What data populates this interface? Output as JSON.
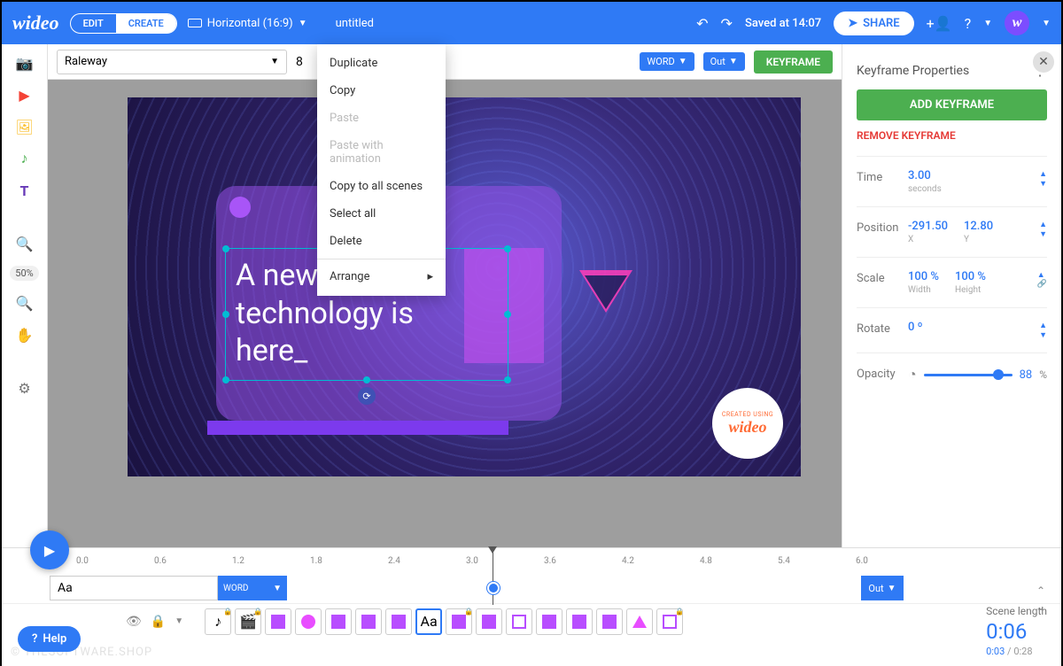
{
  "header": {
    "logo": "wideo",
    "edit": "EDIT",
    "create": "CREATE",
    "orientation": "Horizontal (16:9)",
    "title": "untitled",
    "saved": "Saved at 14:07",
    "share": "SHARE"
  },
  "toolbar": {
    "font": "Raleway",
    "font_size": "8",
    "word_btn": "WORD",
    "out_btn": "Out",
    "keyframe_btn": "KEYFRAME"
  },
  "left_tools": {
    "zoom": "50%"
  },
  "context_menu": {
    "items": [
      {
        "label": "Duplicate",
        "disabled": false
      },
      {
        "label": "Copy",
        "disabled": false
      },
      {
        "label": "Paste",
        "disabled": true
      },
      {
        "label": "Paste with animation",
        "disabled": true
      },
      {
        "label": "Copy to all scenes",
        "disabled": false
      },
      {
        "label": "Select all",
        "disabled": false
      },
      {
        "label": "Delete",
        "disabled": false
      }
    ],
    "arrange": "Arrange"
  },
  "canvas": {
    "text": "A new\ntechnology is\nhere_",
    "badge_small": "CREATED USING",
    "badge_big": "wideo"
  },
  "right_panel": {
    "title": "Keyframe Properties",
    "add": "ADD KEYFRAME",
    "remove": "REMOVE KEYFRAME",
    "time": {
      "label": "Time",
      "value": "3.00",
      "unit": "seconds"
    },
    "position": {
      "label": "Position",
      "x": "-291.50",
      "x_unit": "X",
      "y": "12.80",
      "y_unit": "Y"
    },
    "scale": {
      "label": "Scale",
      "w": "100 %",
      "w_unit": "Width",
      "h": "100 %",
      "h_unit": "Height"
    },
    "rotate": {
      "label": "Rotate",
      "value": "0 º"
    },
    "opacity": {
      "label": "Opacity",
      "value": "88",
      "unit": "%"
    }
  },
  "timeline": {
    "ticks": [
      "0.0",
      "0.6",
      "1.2",
      "1.8",
      "2.4",
      "3.0",
      "3.6",
      "4.2",
      "4.8",
      "5.4",
      "6.0"
    ],
    "track_label": "Aa",
    "track_word": "WORD",
    "track_out": "Out",
    "scene_length_label": "Scene length",
    "scene_length": "0:06",
    "current": "0:03",
    "total": "0:28"
  },
  "help": "Help",
  "watermark": "© THESOFTWARE.SHOP"
}
